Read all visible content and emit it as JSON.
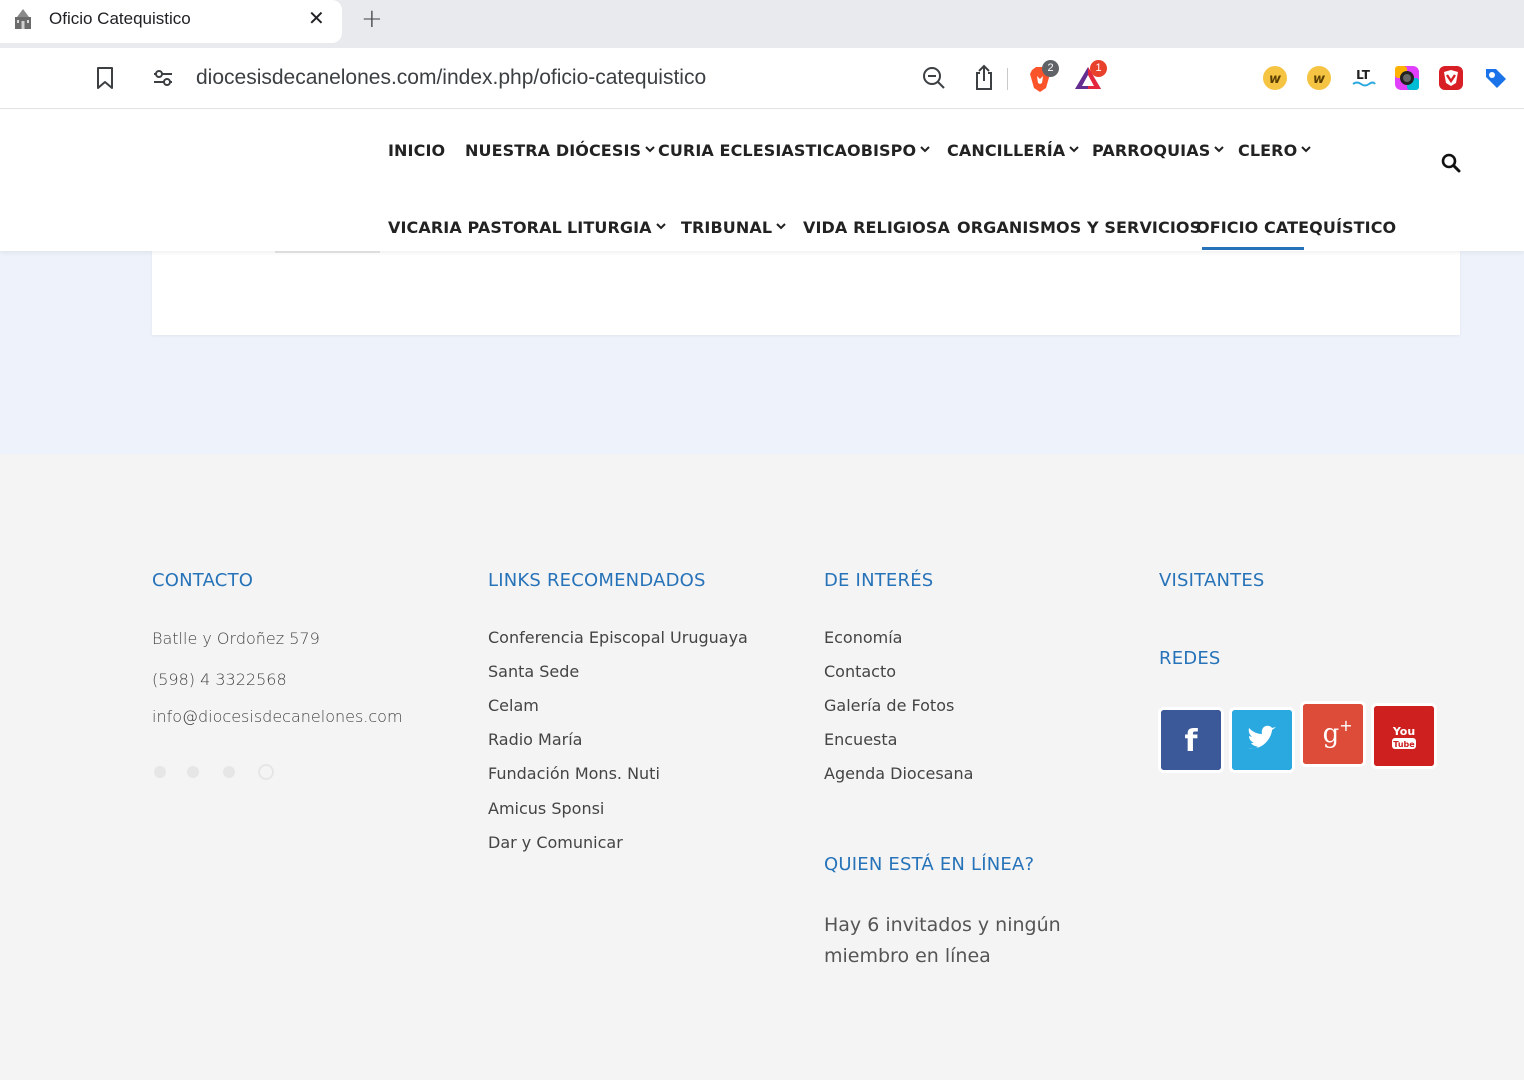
{
  "browser": {
    "tab_title": "Oficio Catequistico",
    "tab_close": "✕",
    "new_tab": "+",
    "url": "diocesisdecanelones.com/index.php/oficio-catequistico",
    "brave_shields_count": "2",
    "rewards_count": "1"
  },
  "nav": {
    "row1": [
      {
        "label": "INICIO",
        "dropdown": false
      },
      {
        "label": "NUESTRA DIÓCESIS",
        "dropdown": true
      },
      {
        "label": "CURIA ECLESIASTICA",
        "dropdown": false
      },
      {
        "label": "OBISPO",
        "dropdown": true
      },
      {
        "label": "CANCILLERÍA",
        "dropdown": true
      },
      {
        "label": "PARROQUIAS",
        "dropdown": true
      },
      {
        "label": "CLERO",
        "dropdown": true
      }
    ],
    "row2": [
      {
        "label": "VICARIA PASTORAL",
        "dropdown": false
      },
      {
        "label": "LITURGIA",
        "dropdown": true
      },
      {
        "label": "TRIBUNAL",
        "dropdown": true
      },
      {
        "label": "VIDA RELIGIOSA",
        "dropdown": false
      },
      {
        "label": "ORGANISMOS Y SERVICIOS",
        "dropdown": false
      },
      {
        "label": "OFICIO CATEQUÍSTICO",
        "dropdown": false,
        "active": true
      }
    ]
  },
  "footer": {
    "contacto": {
      "title": "CONTACTO",
      "address": "Batlle y Ordoñez 579",
      "phone": "(598) 4 3322568",
      "email": "info@diocesisdecanelones.com"
    },
    "links": {
      "title": "LINKS RECOMENDADOS",
      "items": [
        "Conferencia Episcopal Uruguaya",
        "Santa Sede",
        "Celam",
        "Radio María",
        "Fundación Mons. Nuti",
        "Amicus Sponsi",
        "Dar y Comunicar"
      ]
    },
    "interes": {
      "title": "DE INTERÉS",
      "items": [
        "Economía",
        "Contacto",
        "Galería de Fotos",
        "Encuesta",
        "Agenda Diocesana"
      ]
    },
    "online": {
      "title": "QUIEN ESTÁ EN LÍNEA?",
      "text": "Hay 6 invitados y ningún miembro en línea"
    },
    "visitantes": {
      "title": "VISITANTES"
    },
    "redes": {
      "title": "REDES",
      "items": [
        {
          "name": "facebook",
          "glyph": "f",
          "color": "#3b5998"
        },
        {
          "name": "twitter",
          "glyph": "",
          "color": "#2aa9e0"
        },
        {
          "name": "google-plus",
          "glyph": "g+",
          "color": "#dd4b39"
        },
        {
          "name": "youtube",
          "glyph": "You Tube",
          "color": "#cd201f"
        }
      ]
    }
  },
  "colors": {
    "accent": "#2773b9",
    "footer_bg": "#f4f4f4",
    "content_bg": "#eef2fa"
  }
}
